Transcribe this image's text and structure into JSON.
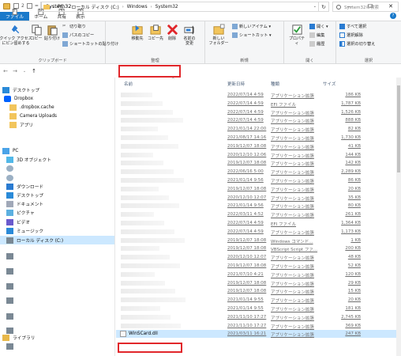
{
  "window": {
    "title": "System32",
    "minimize": "—",
    "maximize": "☐",
    "close": "✕"
  },
  "quick_access_number": "2",
  "tabs": [
    {
      "label": "ファイル",
      "key": "F"
    },
    {
      "label": "ホーム",
      "key": "H"
    },
    {
      "label": "共有",
      "key": "S"
    },
    {
      "label": "表示",
      "key": "V"
    }
  ],
  "help": "?",
  "ribbon": {
    "clipboard": {
      "label": "クリップボード",
      "pin": "クイック アクセス\nにピン留めする",
      "copy": "コピー",
      "paste": "貼り付け",
      "cut": "切り取り",
      "copy_path": "パスのコピー",
      "paste_shortcut": "ショートカットの貼り付け"
    },
    "organize": {
      "label": "整理",
      "move_to": "移動先",
      "copy_to": "コピー先",
      "delete": "削除",
      "rename": "名前の\n変更"
    },
    "new": {
      "label": "新規",
      "new_folder": "新しい\nフォルダー",
      "new_item": "新しいアイテム ▾",
      "shortcut": "ショートカット ▾"
    },
    "open": {
      "label": "開く",
      "properties": "プロパティ",
      "open": "開く ▾",
      "edit": "編集",
      "history": "履歴"
    },
    "select": {
      "label": "選択",
      "select_all": "すべて選択",
      "select_none": "選択解除",
      "invert": "選択の切り替え"
    }
  },
  "address": {
    "back": "←",
    "forward": "→",
    "recent": "⌄",
    "up": "↑",
    "crumbs": [
      "PC",
      "ローカル ディスク (C:)",
      "Windows",
      "System32"
    ],
    "dropdown": "⌄",
    "refresh": "↻",
    "search_placeholder": "System32の検索"
  },
  "nav": [
    {
      "label": "デスクトップ",
      "icon": "desktop"
    },
    {
      "label": "Dropbox",
      "icon": "dropbox"
    },
    {
      "label": ".dropbox.cache",
      "icon": "folder"
    },
    {
      "label": "Camera Uploads",
      "icon": "folder"
    },
    {
      "label": "アプリ",
      "icon": "folder"
    },
    {
      "label": "PC",
      "icon": "pc"
    },
    {
      "label": "3D オブジェクト",
      "icon": "3d"
    },
    {
      "label": "",
      "icon": "person"
    },
    {
      "label": "",
      "icon": "person"
    },
    {
      "label": "ダウンロード",
      "icon": "download"
    },
    {
      "label": "デスクトップ",
      "icon": "desktop"
    },
    {
      "label": "ドキュメント",
      "icon": "document"
    },
    {
      "label": "ピクチャ",
      "icon": "picture"
    },
    {
      "label": "ビデオ",
      "icon": "video"
    },
    {
      "label": "ミュージック",
      "icon": "music"
    },
    {
      "label": "ローカル ディスク (C:)",
      "icon": "drive"
    },
    {
      "label": "",
      "icon": "drive"
    },
    {
      "label": "",
      "icon": "drive"
    },
    {
      "label": "",
      "icon": "drive"
    },
    {
      "label": "",
      "icon": "drive"
    },
    {
      "label": "",
      "icon": "drive"
    },
    {
      "label": "",
      "icon": "drive"
    },
    {
      "label": "",
      "icon": "drive"
    },
    {
      "label": "ライブラリ",
      "icon": "library"
    }
  ],
  "columns": {
    "name": "名前",
    "date": "更新日時",
    "type": "種類",
    "size": "サイズ"
  },
  "files": [
    {
      "name": "",
      "date": "2022/07/14 4:59",
      "type": "アプリケーション拡張",
      "size": "186 KB"
    },
    {
      "name": "",
      "date": "2022/07/14 4:59",
      "type": "EFI ファイル",
      "size": "1,787 KB"
    },
    {
      "name": "",
      "date": "2022/07/14 4:59",
      "type": "アプリケーション拡張",
      "size": "1,526 KB"
    },
    {
      "name": "",
      "date": "2022/07/14 4:59",
      "type": "アプリケーション拡張",
      "size": "888 KB"
    },
    {
      "name": "",
      "date": "2021/01/14 22:00",
      "type": "アプリケーション拡張",
      "size": "82 KB"
    },
    {
      "name": "",
      "date": "2021/08/17 14:16",
      "type": "アプリケーション拡張",
      "size": "1,730 KB"
    },
    {
      "name": "",
      "date": "2019/12/07 18:08",
      "type": "アプリケーション拡張",
      "size": "41 KB"
    },
    {
      "name": "",
      "date": "2020/12/10 12:06",
      "type": "アプリケーション拡張",
      "size": "144 KB"
    },
    {
      "name": "",
      "date": "2019/12/07 18:08",
      "type": "アプリケーション拡張",
      "size": "142 KB"
    },
    {
      "name": "",
      "date": "2022/06/16 5:00",
      "type": "アプリケーション拡張",
      "size": "2,289 KB"
    },
    {
      "name": "",
      "date": "2021/01/14 9:56",
      "type": "アプリケーション拡張",
      "size": "86 KB"
    },
    {
      "name": "",
      "date": "2019/12/07 18:08",
      "type": "アプリケーション拡張",
      "size": "20 KB"
    },
    {
      "name": "",
      "date": "2020/12/10 12:07",
      "type": "アプリケーション拡張",
      "size": "35 KB"
    },
    {
      "name": "",
      "date": "2021/01/14 9:56",
      "type": "アプリケーション拡張",
      "size": "80 KB"
    },
    {
      "name": "",
      "date": "2022/03/11 4:52",
      "type": "アプリケーション拡張",
      "size": "261 KB"
    },
    {
      "name": "",
      "date": "2022/07/14 4:59",
      "type": "EFI ファイル",
      "size": "1,364 KB"
    },
    {
      "name": "",
      "date": "2022/07/14 4:59",
      "type": "アプリケーション拡張",
      "size": "1,173 KB"
    },
    {
      "name": "",
      "date": "2019/12/07 18:08",
      "type": "Windows コマンド...",
      "size": "1 KB"
    },
    {
      "name": "",
      "date": "2019/12/07 18:08",
      "type": "VBScript Script ファ...",
      "size": "200 KB"
    },
    {
      "name": "",
      "date": "2020/12/10 12:07",
      "type": "アプリケーション拡張",
      "size": "48 KB"
    },
    {
      "name": "",
      "date": "2019/12/07 18:08",
      "type": "アプリケーション拡張",
      "size": "52 KB"
    },
    {
      "name": "",
      "date": "2021/07/10 4:21",
      "type": "アプリケーション拡張",
      "size": "120 KB"
    },
    {
      "name": "",
      "date": "2019/12/07 18:08",
      "type": "アプリケーション拡張",
      "size": "29 KB"
    },
    {
      "name": "",
      "date": "2019/12/07 18:08",
      "type": "アプリケーション拡張",
      "size": "15 KB"
    },
    {
      "name": "",
      "date": "2021/01/14 9:55",
      "type": "アプリケーション拡張",
      "size": "20 KB"
    },
    {
      "name": "",
      "date": "2021/01/14 9:55",
      "type": "アプリケーション拡張",
      "size": "181 KB"
    },
    {
      "name": "",
      "date": "2021/11/10 17:27",
      "type": "アプリケーション拡張",
      "size": "2,745 KB"
    },
    {
      "name": "",
      "date": "2021/11/10 17:27",
      "type": "アプリケーション拡張",
      "size": "369 KB"
    },
    {
      "name": "WinSCard.dll",
      "date": "2021/03/11 16:21",
      "type": "アプリケーション拡張",
      "size": "247 KB"
    }
  ],
  "highlight_color": "#e1272b",
  "selection_color": "#cce8ff",
  "accent_color": "#1979ca"
}
